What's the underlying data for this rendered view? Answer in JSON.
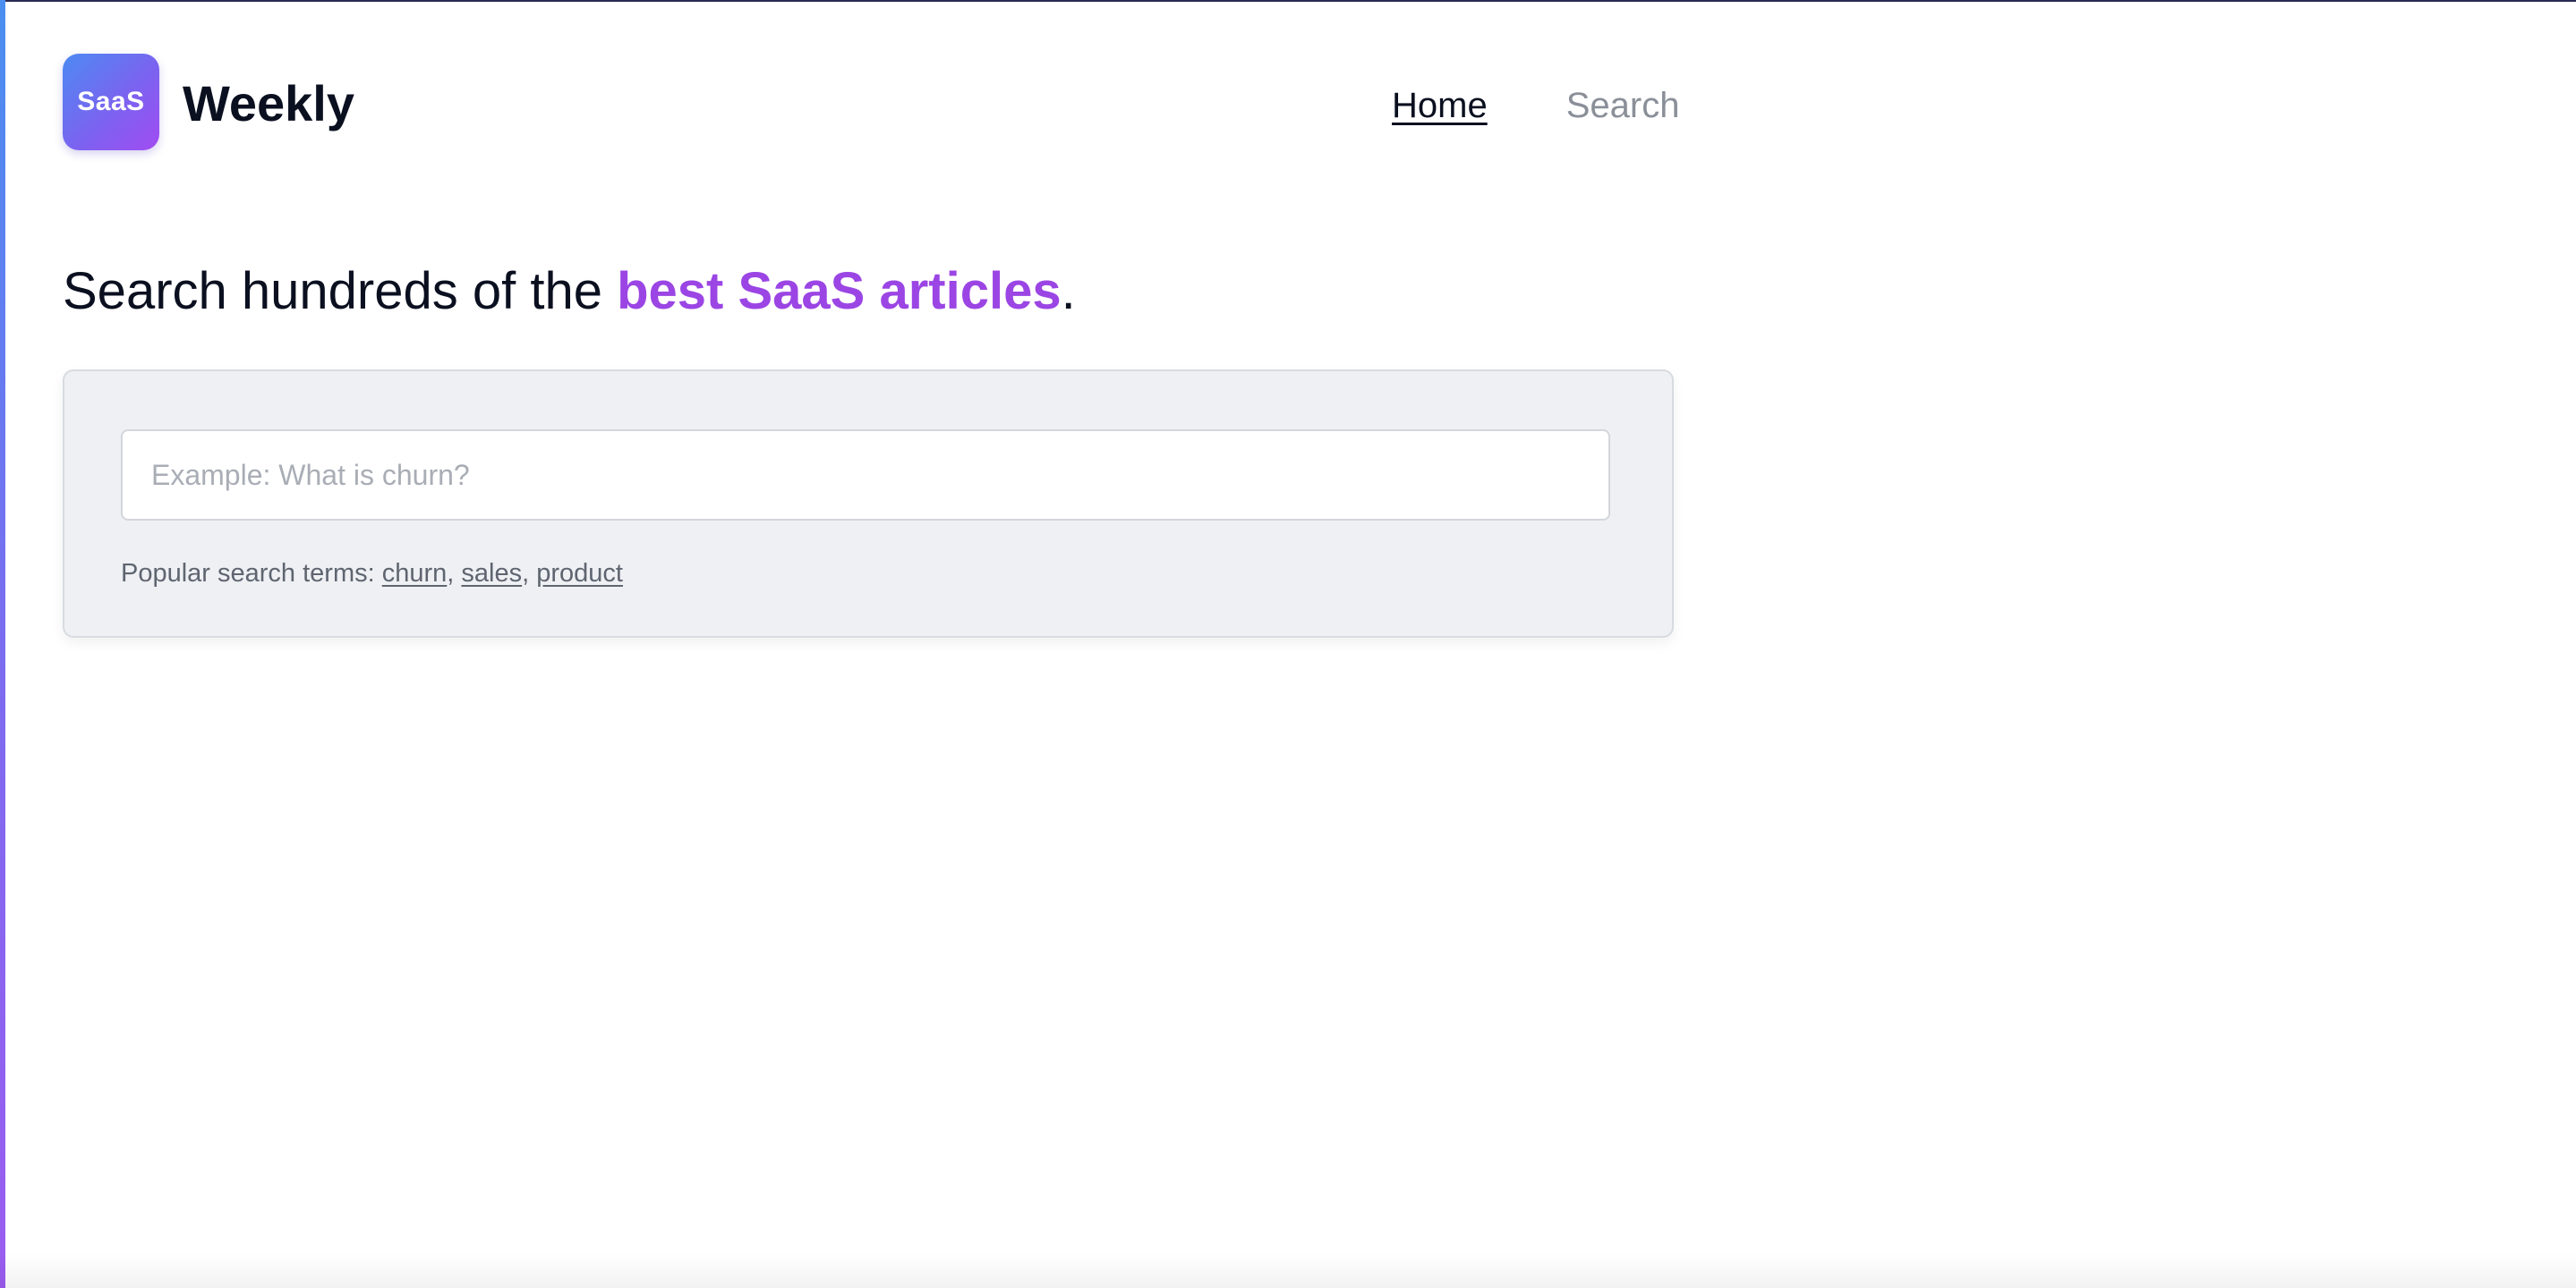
{
  "header": {
    "logo_text": "SaaS",
    "brand_name": "Weekly",
    "nav": {
      "home_label": "Home",
      "search_label": "Search"
    }
  },
  "hero": {
    "heading_prefix": "Search hundreds of the ",
    "heading_highlight": "best SaaS articles",
    "heading_suffix": "."
  },
  "search": {
    "placeholder": "Example: What is churn?",
    "value": "",
    "popular_label": "Popular search terms:",
    "terms": [
      "churn",
      "sales",
      "product"
    ],
    "separator": ", "
  },
  "colors": {
    "accent": "#9b45e4",
    "logo_gradient_start": "#4d8af2",
    "logo_gradient_end": "#a14cf2",
    "panel_background": "#eef0f3",
    "text_primary": "#0b1020",
    "text_muted": "#8a8f98"
  }
}
